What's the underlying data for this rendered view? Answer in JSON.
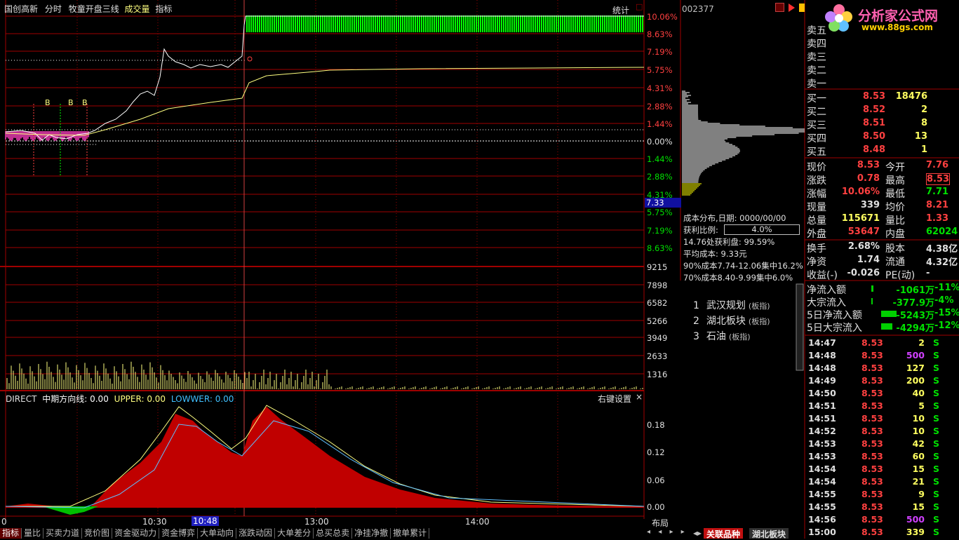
{
  "header": {
    "stock_name": "国创高新",
    "tab_intraday": "分时",
    "tab_indicator_name": "牧童开盘三线",
    "tab_volume": "成交量",
    "tab_index": "指标",
    "stats_btn": "统计",
    "close_x": "□"
  },
  "price_axis": {
    "up": [
      "10.06%",
      "8.63%",
      "7.19%",
      "5.75%",
      "4.31%",
      "2.88%",
      "1.44%"
    ],
    "zero": "0.00%",
    "down": [
      "1.44%",
      "2.88%",
      "4.31%",
      "5.75%",
      "7.19%",
      "8.63%"
    ],
    "cursor_value": "7.33"
  },
  "vol_axis": [
    "9215",
    "7898",
    "6582",
    "5266",
    "3949",
    "2633",
    "1316"
  ],
  "markers": [
    "B",
    "B",
    "B"
  ],
  "indicator": {
    "name": "DIRECT",
    "l1": "中期方向线: 0.00",
    "l2": "UPPER: 0.00",
    "l3": "LOWWER: 0.00",
    "settings": "右键设置",
    "close": "×",
    "axis": [
      "0.18",
      "0.12",
      "0.06",
      "0.00"
    ]
  },
  "time_axis": {
    "t0": "0",
    "t1": "10:30",
    "t2": "10:48",
    "t3": "13:00",
    "t4": "14:00",
    "layout": "布局"
  },
  "code": "002377",
  "logo": {
    "title": "分析家公式网",
    "url": "www.88gs.com"
  },
  "order_book": {
    "asks": [
      {
        "label": "卖五"
      },
      {
        "label": "卖四"
      },
      {
        "label": "卖三"
      },
      {
        "label": "卖二"
      },
      {
        "label": "卖一"
      }
    ],
    "bids": [
      {
        "label": "买一",
        "price": "8.53",
        "vol": "18476"
      },
      {
        "label": "买二",
        "price": "8.52",
        "vol": "2"
      },
      {
        "label": "买三",
        "price": "8.51",
        "vol": "8"
      },
      {
        "label": "买四",
        "price": "8.50",
        "vol": "13"
      },
      {
        "label": "买五",
        "price": "8.48",
        "vol": "1"
      }
    ]
  },
  "quote": [
    {
      "l": "现价",
      "v": "8.53",
      "l2": "今开",
      "v2": "7.76"
    },
    {
      "l": "涨跌",
      "v": "0.78",
      "l2": "最高",
      "v2": "8.53"
    },
    {
      "l": "涨幅",
      "v": "10.06%",
      "l2": "最低",
      "v2": "7.71"
    },
    {
      "l": "现量",
      "v": "339",
      "l2": "均价",
      "v2": "8.21"
    },
    {
      "l": "总量",
      "v": "115671",
      "l2": "量比",
      "v2": "1.33"
    },
    {
      "l": "外盘",
      "v": "53647",
      "l2": "内盘",
      "v2": "62024"
    },
    {
      "l": "换手",
      "v": "2.68%",
      "l2": "股本",
      "v2": "4.38亿"
    },
    {
      "l": "净资",
      "v": "1.74",
      "l2": "流通",
      "v2": "4.32亿"
    },
    {
      "l": "收益(-)",
      "v": "-0.026",
      "l2": "PE(动)",
      "v2": "-"
    }
  ],
  "flows": [
    {
      "l": "净流入额",
      "v": "-1061万",
      "p": "-11%"
    },
    {
      "l": "大宗流入",
      "v": "-377.9万",
      "p": "-4%"
    },
    {
      "l": "5日净流入额",
      "v": "-5243万",
      "p": "-15%"
    },
    {
      "l": "5日大宗流入",
      "v": "-4294万",
      "p": "-12%"
    }
  ],
  "ticks": [
    {
      "t": "14:47",
      "p": "8.53",
      "v": "2",
      "s": "S"
    },
    {
      "t": "14:48",
      "p": "8.53",
      "v": "500",
      "s": "S"
    },
    {
      "t": "14:48",
      "p": "8.53",
      "v": "127",
      "s": "S"
    },
    {
      "t": "14:49",
      "p": "8.53",
      "v": "200",
      "s": "S"
    },
    {
      "t": "14:50",
      "p": "8.53",
      "v": "40",
      "s": "S"
    },
    {
      "t": "14:51",
      "p": "8.53",
      "v": "5",
      "s": "S"
    },
    {
      "t": "14:51",
      "p": "8.53",
      "v": "10",
      "s": "S"
    },
    {
      "t": "14:52",
      "p": "8.53",
      "v": "10",
      "s": "S"
    },
    {
      "t": "14:53",
      "p": "8.53",
      "v": "42",
      "s": "S"
    },
    {
      "t": "14:53",
      "p": "8.53",
      "v": "60",
      "s": "S"
    },
    {
      "t": "14:54",
      "p": "8.53",
      "v": "15",
      "s": "S"
    },
    {
      "t": "14:54",
      "p": "8.53",
      "v": "21",
      "s": "S"
    },
    {
      "t": "14:55",
      "p": "8.53",
      "v": "9",
      "s": "S"
    },
    {
      "t": "14:55",
      "p": "8.53",
      "v": "15",
      "s": "S"
    },
    {
      "t": "14:56",
      "p": "8.53",
      "v": "500",
      "s": "S"
    },
    {
      "t": "15:00",
      "p": "8.53",
      "v": "339",
      "s": "S"
    }
  ],
  "cost": {
    "l1": "成本分布,日期: 0000/00/00",
    "l2": "获利比例:",
    "ratio": "4.0%",
    "l3": "14.76处获利盘: 99.59%",
    "l4": "平均成本: 9.33元",
    "l5": "90%成本7.74-12.06集中16.2%",
    "l6": "70%成本8.40-9.99集中6.0%"
  },
  "related": [
    {
      "n": "1",
      "name": "武汉规划",
      "tag": "(板指)"
    },
    {
      "n": "2",
      "name": "湖北板块",
      "tag": "(板指)"
    },
    {
      "n": "3",
      "name": "石油",
      "tag": "(板指)"
    }
  ],
  "bottom_tabs": [
    "指标",
    "量比",
    "买卖力道",
    "竞价图",
    "资金驱动力",
    "资金博弈",
    "大单动向",
    "涨跌动因",
    "大单差分",
    "总买总卖",
    "净挂净撤",
    "撤单累计"
  ],
  "right_tabs": [
    "关联品种",
    "湖北板块"
  ],
  "colors": {
    "up": "#ff3030",
    "green": "#00ff00",
    "grid": "#a00000",
    "yellow": "#ffff00"
  }
}
